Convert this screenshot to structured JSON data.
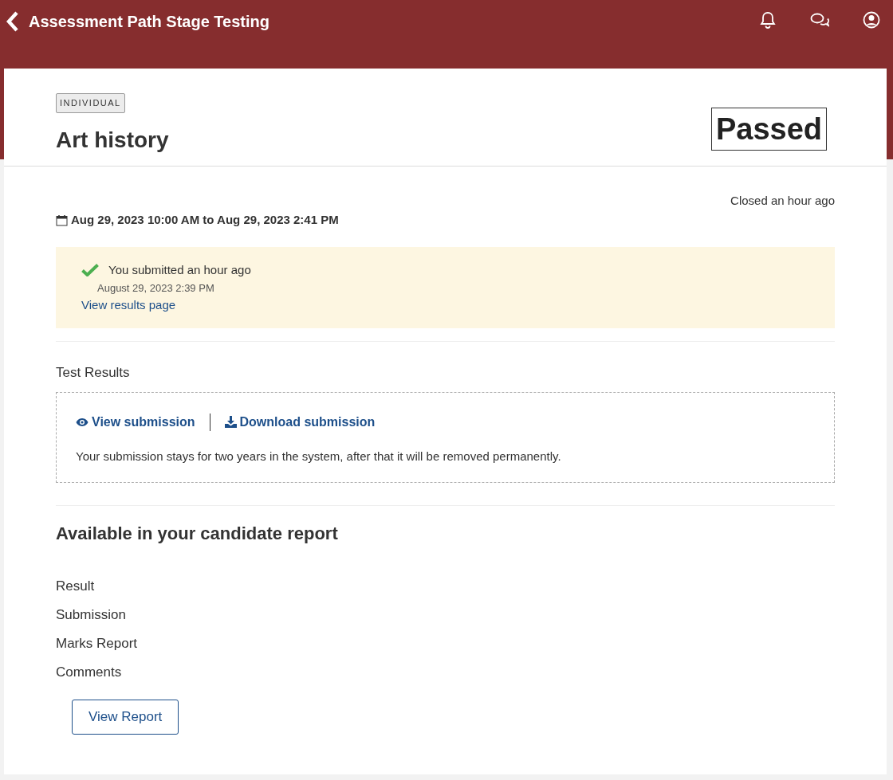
{
  "header": {
    "title": "Assessment Path Stage Testing"
  },
  "assessment": {
    "badge": "INDIVIDUAL",
    "title": "Art history",
    "result": "Passed"
  },
  "schedule": {
    "status": "Closed an hour ago",
    "range": "Aug 29, 2023 10:00 AM to Aug 29, 2023 2:41 PM"
  },
  "submission_notice": {
    "message": "You submitted an hour ago",
    "timestamp": "August 29, 2023 2:39 PM",
    "link": "View results page"
  },
  "test_results": {
    "heading": "Test Results",
    "actions": [
      {
        "kind": "view",
        "label": "View submission"
      },
      {
        "kind": "download",
        "label": "Download submission"
      }
    ],
    "note": "Your submission stays for two years in the system, after that it will be removed permanently."
  },
  "candidate_report": {
    "heading": "Available in your candidate report",
    "items": [
      "Result",
      "Submission",
      "Marks Report",
      "Comments"
    ],
    "button": "View Report"
  }
}
